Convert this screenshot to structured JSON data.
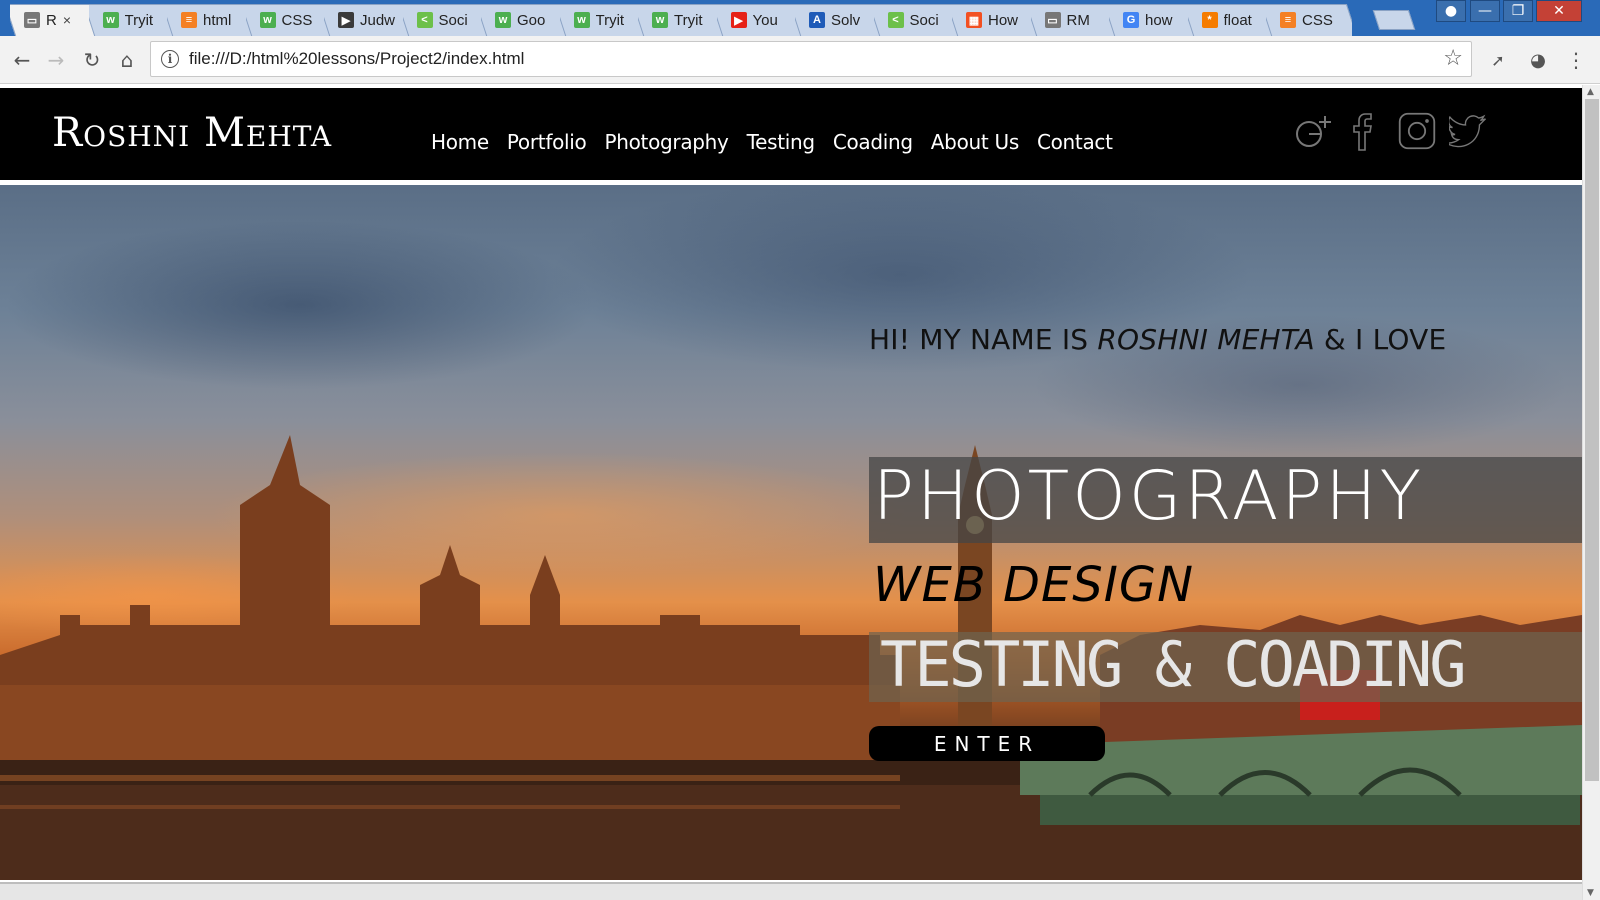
{
  "browser": {
    "tabs": [
      {
        "label": "R",
        "favicon": "document-icon",
        "color": "#777777",
        "active": true
      },
      {
        "label": "Tryit",
        "favicon": "w3schools-icon",
        "color": "#4caf50"
      },
      {
        "label": "html",
        "favicon": "stackoverflow-icon",
        "color": "#f48024"
      },
      {
        "label": "CSS",
        "favicon": "w3schools-icon",
        "color": "#4caf50"
      },
      {
        "label": "Judw",
        "favicon": "video-icon",
        "color": "#3a3a3a"
      },
      {
        "label": "Soci",
        "favicon": "share-icon",
        "color": "#6cc04a"
      },
      {
        "label": "Goo",
        "favicon": "w3schools-icon",
        "color": "#4caf50"
      },
      {
        "label": "Tryit",
        "favicon": "w3schools-icon",
        "color": "#4caf50"
      },
      {
        "label": "Tryit",
        "favicon": "w3schools-icon",
        "color": "#4caf50"
      },
      {
        "label": "You",
        "favicon": "youtube-icon",
        "color": "#e62117"
      },
      {
        "label": "Solv",
        "favicon": "a-icon",
        "color": "#1e5bb8"
      },
      {
        "label": "Soci",
        "favicon": "share-icon",
        "color": "#6cc04a"
      },
      {
        "label": "How",
        "favicon": "windows-icon",
        "color": "#f25022"
      },
      {
        "label": "RM",
        "favicon": "document-icon",
        "color": "#777777"
      },
      {
        "label": "how",
        "favicon": "google-icon",
        "color": "#4285f4"
      },
      {
        "label": "float",
        "favicon": "asterisk-icon",
        "color": "#f57c00"
      },
      {
        "label": "CSS",
        "favicon": "stackoverflow-icon",
        "color": "#f48024"
      }
    ],
    "url": "file:///D:/html%20lessons/Project2/index.html"
  },
  "site": {
    "logo": "Roshni Mehta",
    "nav": [
      "Home",
      "Portfolio",
      "Photography",
      "Testing",
      "Coading",
      "About Us",
      "Contact"
    ],
    "socials": [
      "google-plus-icon",
      "facebook-icon",
      "instagram-icon",
      "twitter-icon"
    ]
  },
  "hero": {
    "tagline_pre": "HI! MY NAME IS ",
    "tagline_name": "ROSHNI MEHTA",
    "tagline_post": " & I LOVE",
    "word1": "PHOTOGRAPHY",
    "word2": "WEB DESIGN",
    "word3": "TESTING & COADING",
    "button": "ENTER"
  }
}
